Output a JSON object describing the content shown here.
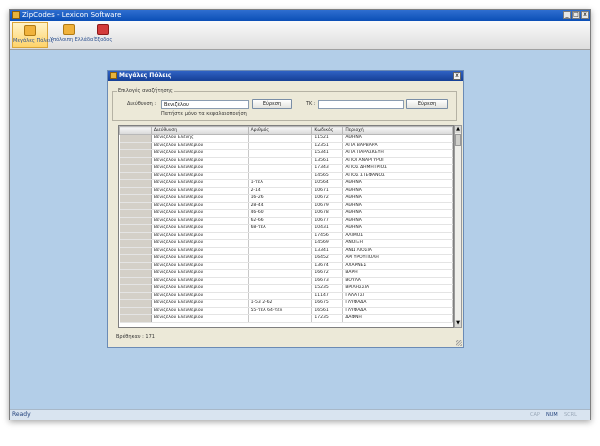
{
  "app": {
    "title": "ZipCodes - Lexicon Software"
  },
  "window_controls": {
    "minimize": "_",
    "maximize": "□",
    "close": "x"
  },
  "toolbar": {
    "buttons": [
      {
        "label": "Μεγάλες Πόλεις",
        "icon": "folder-icon"
      },
      {
        "label": "Υπόλοιπη Ελλάδα",
        "icon": "folder-icon"
      },
      {
        "label": "Έξοδος",
        "icon": "exit-icon"
      }
    ]
  },
  "status": {
    "text": "Ready",
    "indicators": [
      "CAP",
      "NUM",
      "SCRL"
    ]
  },
  "dialog": {
    "title": "Μεγάλες Πόλεις",
    "close": "x",
    "group_label": "Επιλογές αναζήτησης",
    "address_label": "Διεύθυνση :",
    "address_value": "Βενιζέλου",
    "hint": "Πατήστε μόνο τα κεφαλαιοποιήση",
    "search_button": "Εύρεση",
    "tk_label": "ΤΚ :",
    "tk_value": "",
    "search_button_2": "Εύρεση",
    "columns": [
      "",
      "Διεύθυνση",
      "Αριθμός",
      "Κωδικός",
      "Περιοχή"
    ],
    "rows": [
      [
        "Βενιζέλου Ελένης",
        "",
        "11521",
        "ΑΘΗΝΑ"
      ],
      [
        "Βενιζέλου Ελευθερίου",
        "",
        "12351",
        "ΑΓΙΑ ΒΑΡΒΑΡΑ"
      ],
      [
        "Βενιζέλου Ελευθερίου",
        "",
        "15341",
        "ΑΓΙΑ ΠΑΡΑΣΚΕΥΗ"
      ],
      [
        "Βενιζέλου Ελευθερίου",
        "",
        "13561",
        "ΑΓΙΟΙ ΑΝΑΡΓΥΡΟΙ"
      ],
      [
        "Βενιζέλου Ελευθερίου",
        "",
        "17343",
        "ΑΓΙΟΣ ΔΗΜΗΤΡΙΟΣ"
      ],
      [
        "Βενιζέλου Ελευθερίου",
        "",
        "14565",
        "ΑΓΙΟΣ ΣΤΕΦΑΝΟΣ"
      ],
      [
        "Βενιζέλου Ελευθερίου",
        "1-τέλ",
        "10564",
        "ΑΘΗΝΑ"
      ],
      [
        "Βενιζέλου Ελευθερίου",
        "2-14",
        "10671",
        "ΑΘΗΝΑ"
      ],
      [
        "Βενιζέλου Ελευθερίου",
        "16-26",
        "10672",
        "ΑΘΗΝΑ"
      ],
      [
        "Βενιζέλου Ελευθερίου",
        "28-44",
        "10679",
        "ΑΘΗΝΑ"
      ],
      [
        "Βενιζέλου Ελευθερίου",
        "46-60",
        "10678",
        "ΑΘΗΝΑ"
      ],
      [
        "Βενιζέλου Ελευθερίου",
        "62-66",
        "10677",
        "ΑΘΗΝΑ"
      ],
      [
        "Βενιζέλου Ελευθερίου",
        "68-τέλ",
        "10431",
        "ΑΘΗΝΑ"
      ],
      [
        "Βενιζέλου Ελευθερίου",
        "",
        "17456",
        "ΑΛΙΜΟΣ"
      ],
      [
        "Βενιζέλου Ελευθερίου",
        "",
        "14569",
        "ΑΝΟΙΞΗ"
      ],
      [
        "Βενιζέλου Ελευθερίου",
        "",
        "13341",
        "ΑΝΩ ΛΙΟΣΙΑ"
      ],
      [
        "Βενιζέλου Ελευθερίου",
        "",
        "16452",
        "ΑΡΓΥΡΟΥΠΟΛΗ"
      ],
      [
        "Βενιζέλου Ελευθερίου",
        "",
        "13674",
        "ΑΧΑΡΝΕΣ"
      ],
      [
        "Βενιζέλου Ελευθερίου",
        "",
        "16672",
        "ΒΑΡΗ"
      ],
      [
        "Βενιζέλου Ελευθερίου",
        "",
        "16673",
        "ΒΟΥΛΑ"
      ],
      [
        "Βενιζέλου Ελευθερίου",
        "",
        "15235",
        "ΒΡΙΛΗΣΣΙΑ"
      ],
      [
        "Βενιζέλου Ελευθερίου",
        "",
        "11147",
        "ΓΑΛΑΤΣΙ"
      ],
      [
        "Βενιζέλου Ελευθερίου",
        "1-53   2-62",
        "16675",
        "ΓΛΥΦΑΔΑ"
      ],
      [
        "Βενιζέλου Ελευθερίου",
        "55-τέλ  64-τέλ",
        "16561",
        "ΓΛΥΦΑΔΑ"
      ],
      [
        "Βενιζέλου Ελευθερίου",
        "",
        "17235",
        "ΔΑΦΝΗ"
      ]
    ],
    "count_text": "Βρέθηκαν : 171"
  }
}
